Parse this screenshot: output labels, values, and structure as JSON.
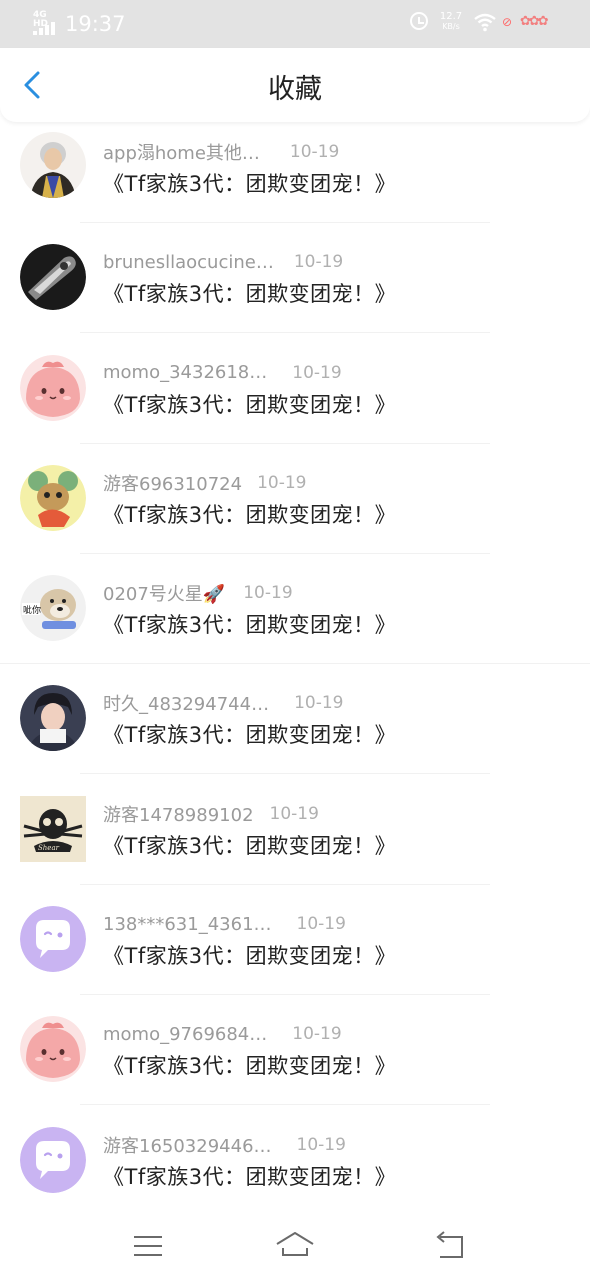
{
  "status_bar": {
    "network": "4G HD",
    "time": "19:37",
    "speed_value": "12.7",
    "speed_unit": "KB/s",
    "icons": [
      "signal-icon",
      "alarm-icon",
      "wifi-icon",
      "vpn-icon",
      "battery-icon"
    ]
  },
  "header": {
    "back_icon": "chevron-left-icon",
    "title": "收藏",
    "accent": "#2a8fe0"
  },
  "favorites": [
    {
      "name": "app溻home其他…",
      "date": "10-19",
      "text": "《Tf家族3代：团欺变团宠！》",
      "avatar": "photo-boy-hoodie"
    },
    {
      "name": "brunesllaocucine…",
      "date": "10-19",
      "text": "《Tf家族3代：团欺变团宠！》",
      "avatar": "photo-dark-object"
    },
    {
      "name": "momo_3432618…",
      "date": "10-19",
      "text": "《Tf家族3代：团欺变团宠！》",
      "avatar": "pink-blob"
    },
    {
      "name": "游客696310724",
      "date": "10-19",
      "text": "《Tf家族3代：团欺变团宠！》",
      "avatar": "cartoon-mouse"
    },
    {
      "name": "0207号火星🚀",
      "date": "10-19",
      "text": "《Tf家族3代：团欺变团宠！》",
      "avatar": "dog-meme"
    },
    {
      "name": "时久_483294744…",
      "date": "10-19",
      "text": "《Tf家族3代：团欺变团宠！》",
      "avatar": "photo-boy"
    },
    {
      "name": "游客1478989102",
      "date": "10-19",
      "text": "《Tf家族3代：团欺变团宠！》",
      "avatar": "skull-logo"
    },
    {
      "name": "138***631_4361…",
      "date": "10-19",
      "text": "《Tf家族3代：团欺变团宠！》",
      "avatar": "purple-chat"
    },
    {
      "name": "momo_9769684…",
      "date": "10-19",
      "text": "《Tf家族3代：团欺变团宠！》",
      "avatar": "pink-blob"
    },
    {
      "name": "游客1650329446…",
      "date": "10-19",
      "text": "《Tf家族3代：团欺变团宠！》",
      "avatar": "purple-chat"
    }
  ],
  "nav_bar": {
    "icons": [
      "menu-icon",
      "home-icon",
      "back-nav-icon"
    ]
  }
}
